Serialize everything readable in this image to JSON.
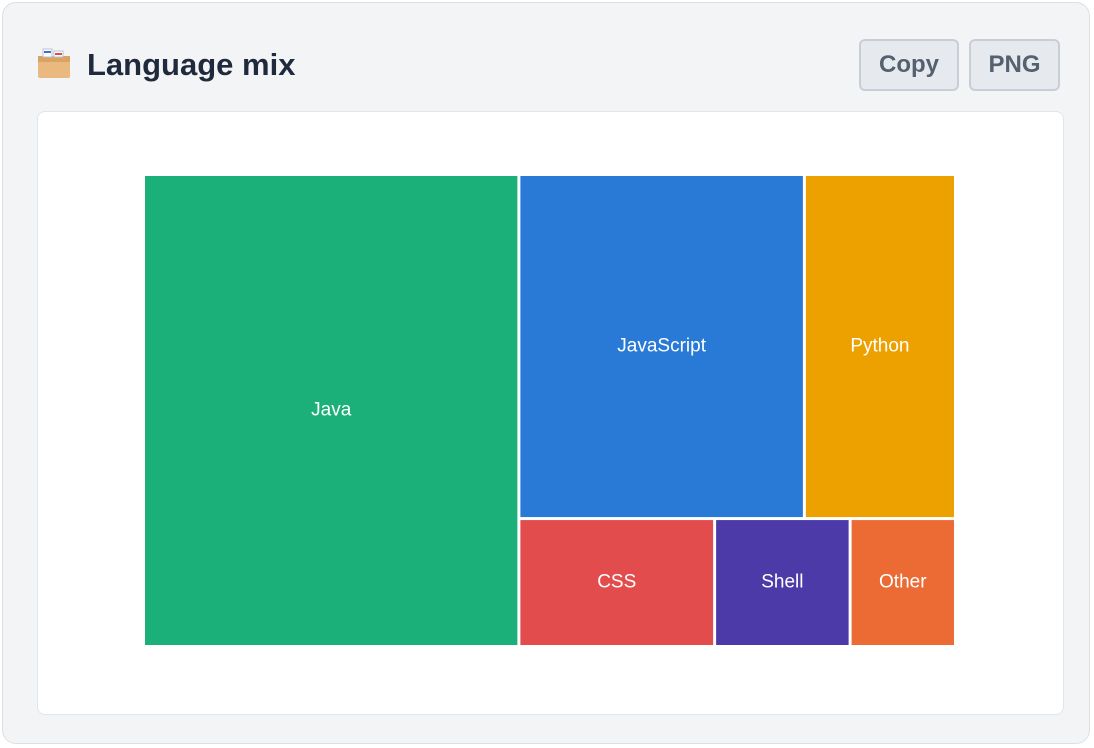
{
  "panel": {
    "title": "Language mix",
    "copy_label": "Copy",
    "png_label": "PNG",
    "icon": "card-file-box-icon"
  },
  "chart_data": {
    "type": "treemap",
    "title": "Language mix",
    "categories": [
      "Java",
      "JavaScript",
      "Python",
      "CSS",
      "Shell",
      "Other"
    ],
    "values": [
      46,
      25.5,
      13.5,
      6.5,
      4.5,
      3.5
    ],
    "unit": "%",
    "colors": {
      "Java": "#1bb07a",
      "JavaScript": "#2979d6",
      "Python": "#eca100",
      "CSS": "#e34c4c",
      "Shell": "#4b3aa7",
      "Other": "#ec6b34"
    }
  }
}
